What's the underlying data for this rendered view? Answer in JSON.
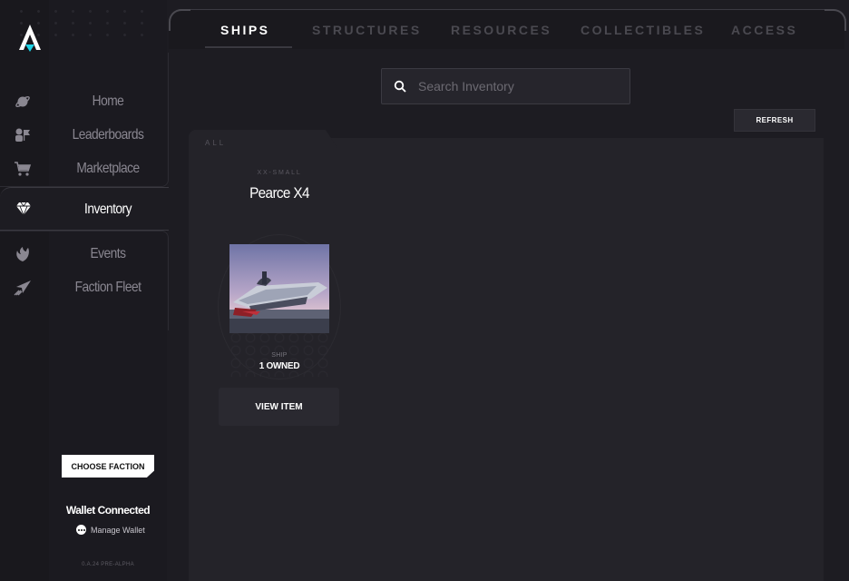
{
  "sidebar": {
    "logo_icon": "star-atlas-logo-icon",
    "items": [
      {
        "label": "Home",
        "icon": "planet-icon"
      },
      {
        "label": "Leaderboards",
        "icon": "podium-icon"
      },
      {
        "label": "Marketplace",
        "icon": "cart-icon"
      },
      {
        "label": "Inventory",
        "icon": "diamond-icon",
        "active": true
      },
      {
        "label": "Events",
        "icon": "phoenix-icon"
      },
      {
        "label": "Faction Fleet",
        "icon": "fleet-icon"
      }
    ],
    "choose_faction": "CHOOSE FACTION",
    "wallet_status": "Wallet Connected",
    "manage_wallet": "Manage Wallet",
    "version": "0.A.24 PRE-ALPHA"
  },
  "tabs": [
    {
      "label": "SHIPS",
      "active": true
    },
    {
      "label": "STRUCTURES"
    },
    {
      "label": "RESOURCES"
    },
    {
      "label": "COLLECTIBLES"
    },
    {
      "label": "ACCESS"
    }
  ],
  "search": {
    "placeholder": "Search Inventory",
    "value": ""
  },
  "refresh_label": "REFRESH",
  "filter_tab": "ALL",
  "items": [
    {
      "category": "XX-SMALL",
      "name": "Pearce X4",
      "type": "SHIP",
      "owned": "1 OWNED",
      "action": "VIEW ITEM"
    }
  ],
  "colors": {
    "background": "#1d1c22",
    "panel": "#242329",
    "accent": "#1fd3e6",
    "text": "#ffffff",
    "muted": "#8a8791"
  }
}
